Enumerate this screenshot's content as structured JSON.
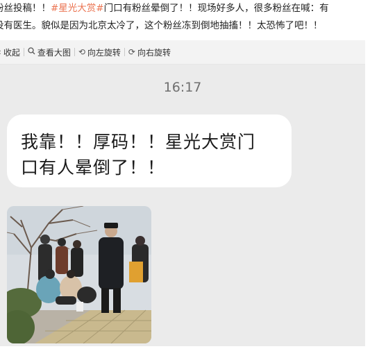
{
  "post": {
    "line1_prefix": "粉丝投稿！！",
    "hashtag": "#星光大赏#",
    "line1_suffix": "门口有粉丝晕倒了！！现场好多人，很多粉丝在喊：有",
    "line2": "没有医生。貌似是因为北京太冷了，这个粉丝冻到倒地抽搐！！太恐怖了吧！！"
  },
  "toolbar": {
    "collapse": "收起",
    "view_large": "查看大图",
    "rotate_left": "向左旋转",
    "rotate_right": "向右旋转"
  },
  "chat": {
    "time": "16:17",
    "message_line1": "我靠！！厚码！！星光大赏门",
    "message_line2": "口有人晕倒了！！"
  },
  "colors": {
    "hashtag": "#eb7350",
    "chat_bg": "#ebebeb",
    "bubble": "#ffffff"
  },
  "icons": [
    "collapse-icon",
    "magnifier-icon",
    "rotate-left-icon",
    "rotate-right-icon"
  ]
}
